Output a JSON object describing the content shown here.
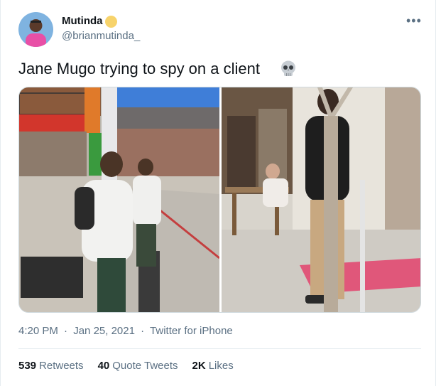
{
  "user": {
    "name": "Mutinda",
    "handle": "@brianmutinda_"
  },
  "tweet": {
    "text": "Jane Mugo trying to spy on a client",
    "emoji": "skull-icon"
  },
  "meta": {
    "time": "4:20 PM",
    "separator1": "·",
    "date": "Jan 25, 2021",
    "separator2": "·",
    "source": "Twitter for iPhone"
  },
  "stats": {
    "retweets_count": "539",
    "retweets_label": "Retweets",
    "quotes_count": "40",
    "quotes_label": "Quote Tweets",
    "likes_count": "2K",
    "likes_label": "Likes"
  },
  "colors": {
    "text_primary": "#0f1419",
    "text_secondary": "#5b7083",
    "border": "#e6ecf0",
    "verified": "#f7d36b"
  }
}
